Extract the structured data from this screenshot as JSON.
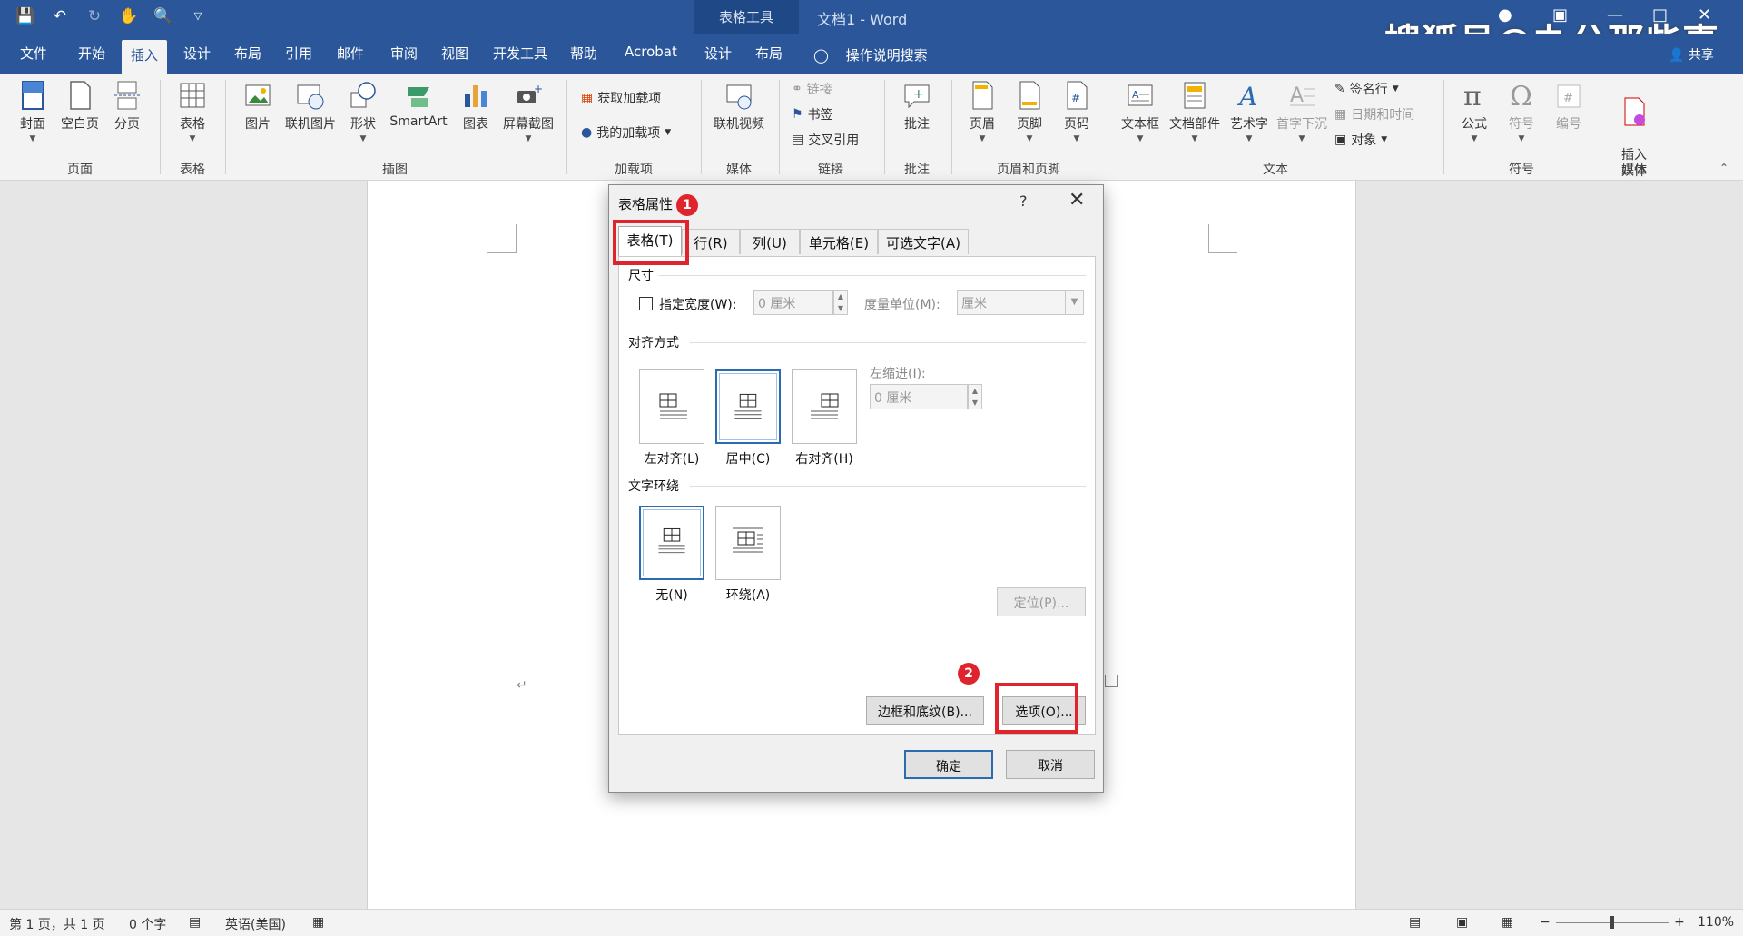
{
  "titlebar": {
    "context_tools": "表格工具",
    "doc_title": "文档1  -  Word",
    "watermark": "搜狐号@办公那些事",
    "share": "共享"
  },
  "tabs": [
    "文件",
    "开始",
    "插入",
    "设计",
    "布局",
    "引用",
    "邮件",
    "审阅",
    "视图",
    "开发工具",
    "帮助",
    "Acrobat",
    "设计",
    "布局"
  ],
  "active_tab": "插入",
  "search": "操作说明搜索",
  "ribbon": {
    "groups": {
      "pages": "页面",
      "tables": "表格",
      "illustrations": "插图",
      "addins": "加载项",
      "media": "媒体",
      "links": "链接",
      "comments": "批注",
      "header_footer": "页眉和页脚",
      "text": "文本",
      "symbols": "符号",
      "media2": "媒体"
    },
    "buttons": {
      "cover": "封面",
      "blank": "空白页",
      "break": "分页",
      "table": "表格",
      "picture": "图片",
      "online_picture": "联机图片",
      "shapes": "形状",
      "smartart": "SmartArt",
      "chart": "图表",
      "screenshot": "屏幕截图",
      "get_addins": "获取加载项",
      "my_addins": "我的加载项",
      "online_video": "联机视频",
      "link": "链接",
      "bookmark": "书签",
      "cross_ref": "交叉引用",
      "comment": "批注",
      "header": "页眉",
      "footer": "页脚",
      "page_number": "页码",
      "textbox": "文本框",
      "quickparts": "文档部件",
      "wordart": "艺术字",
      "dropcap": "首字下沉",
      "signature": "签名行",
      "datetime": "日期和时间",
      "object": "对象",
      "equation": "公式",
      "symbol": "符号",
      "numbering": "编号",
      "insert_media": "插入\n媒体"
    }
  },
  "dialog": {
    "title": "表格属性",
    "help": "?",
    "tabs": [
      "表格(T)",
      "行(R)",
      "列(U)",
      "单元格(E)",
      "可选文字(A)"
    ],
    "size_section": "尺寸",
    "specify_width": "指定宽度(W):",
    "width_value": "0 厘米",
    "measure_in": "度量单位(M):",
    "measure_value": "厘米",
    "alignment_section": "对齐方式",
    "align_left": "左对齐(L)",
    "align_center": "居中(C)",
    "align_right": "右对齐(H)",
    "indent_label": "左缩进(I):",
    "indent_value": "0 厘米",
    "wrap_section": "文字环绕",
    "wrap_none": "无(N)",
    "wrap_around": "环绕(A)",
    "positioning": "定位(P)...",
    "borders": "边框和底纹(B)...",
    "options": "选项(O)...",
    "ok": "确定",
    "cancel": "取消"
  },
  "badges": [
    "1",
    "2"
  ],
  "statusbar": {
    "page": "第 1 页，共 1 页",
    "words": "0 个字",
    "language": "英语(美国)",
    "zoom": "110%"
  }
}
